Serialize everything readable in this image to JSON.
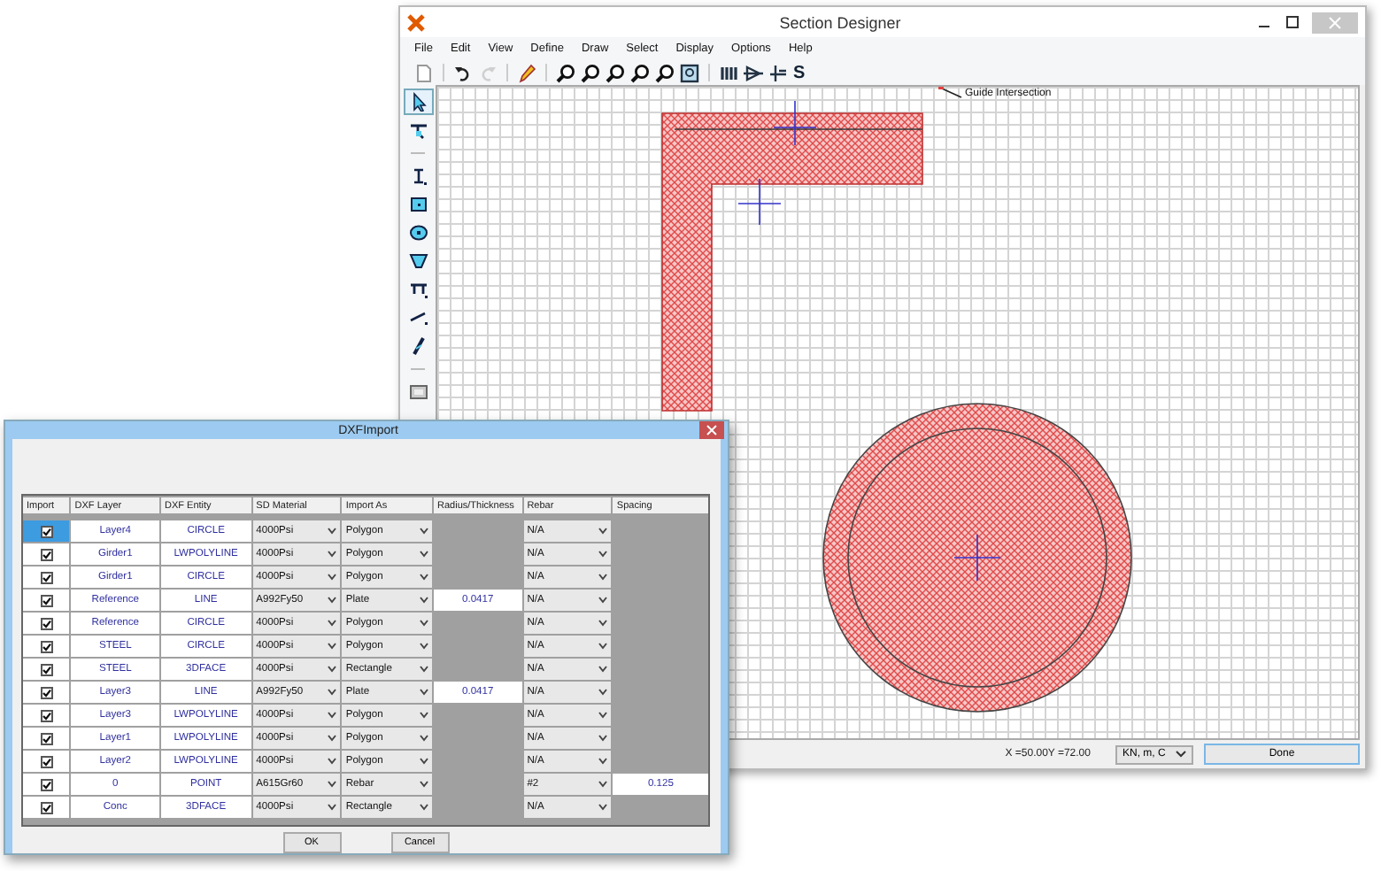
{
  "main_window": {
    "title": "Section Designer",
    "menu": [
      "File",
      "Edit",
      "View",
      "Define",
      "Draw",
      "Select",
      "Display",
      "Options",
      "Help"
    ],
    "toolbar": [
      {
        "kind": "new"
      },
      {
        "kind": "sep"
      },
      {
        "kind": "undo"
      },
      {
        "kind": "redo",
        "disabled": true
      },
      {
        "kind": "sep"
      },
      {
        "kind": "pencil"
      },
      {
        "kind": "sep"
      },
      {
        "kind": "zoom"
      },
      {
        "kind": "zoom"
      },
      {
        "kind": "zoom"
      },
      {
        "kind": "zoom"
      },
      {
        "kind": "zoom"
      },
      {
        "kind": "fit"
      },
      {
        "kind": "sep"
      },
      {
        "kind": "bars"
      },
      {
        "kind": "triangle"
      },
      {
        "kind": "axis"
      },
      {
        "kind": "text",
        "label": "S"
      }
    ],
    "side_tools": [
      {
        "kind": "pointer",
        "selected": true
      },
      {
        "kind": "reshape",
        "selected": false
      },
      {
        "kind": "sep"
      },
      {
        "kind": "ibeam",
        "selected": false
      },
      {
        "kind": "rect",
        "selected": false
      },
      {
        "kind": "circle",
        "selected": false
      },
      {
        "kind": "poly",
        "selected": false
      },
      {
        "kind": "tee",
        "selected": false
      },
      {
        "kind": "line",
        "selected": false
      },
      {
        "kind": "pen",
        "selected": false
      },
      {
        "kind": "sep"
      },
      {
        "kind": "props",
        "selected": false
      }
    ],
    "canvas": {
      "guide_label": "Guide Intersection"
    },
    "status_bar": {
      "coordinates": "X =50.00Y =72.00",
      "units": "KN, m, C",
      "done_button": "Done"
    }
  },
  "dialog": {
    "title": "DXFImport",
    "columns": [
      "Import",
      "DXF Layer",
      "DXF Entity",
      "SD Material",
      "Import As",
      "Radius/Thickness",
      "Rebar",
      "Spacing"
    ],
    "rows": [
      {
        "import": true,
        "layer": "Layer4",
        "entity": "CIRCLE",
        "material": "4000Psi",
        "import_as": "Polygon",
        "rebar": "N/A",
        "selected": true
      },
      {
        "import": true,
        "layer": "Girder1",
        "entity": "LWPOLYLINE",
        "material": "4000Psi",
        "import_as": "Polygon",
        "rebar": "N/A",
        "selected": false
      },
      {
        "import": true,
        "layer": "Girder1",
        "entity": "CIRCLE",
        "material": "4000Psi",
        "import_as": "Polygon",
        "rebar": "N/A",
        "selected": false
      },
      {
        "import": true,
        "layer": "Reference",
        "entity": "LINE",
        "material": "A992Fy50",
        "import_as": "Plate",
        "radius": "0.0417",
        "rebar": "N/A",
        "selected": false
      },
      {
        "import": true,
        "layer": "Reference",
        "entity": "CIRCLE",
        "material": "4000Psi",
        "import_as": "Polygon",
        "rebar": "N/A",
        "selected": false
      },
      {
        "import": true,
        "layer": "STEEL",
        "entity": "CIRCLE",
        "material": "4000Psi",
        "import_as": "Polygon",
        "rebar": "N/A",
        "selected": false
      },
      {
        "import": true,
        "layer": "STEEL",
        "entity": "3DFACE",
        "material": "4000Psi",
        "import_as": "Rectangle",
        "rebar": "N/A",
        "selected": false
      },
      {
        "import": true,
        "layer": "Layer3",
        "entity": "LINE",
        "material": "A992Fy50",
        "import_as": "Plate",
        "radius": "0.0417",
        "rebar": "N/A",
        "selected": false
      },
      {
        "import": true,
        "layer": "Layer3",
        "entity": "LWPOLYLINE",
        "material": "4000Psi",
        "import_as": "Polygon",
        "rebar": "N/A",
        "selected": false
      },
      {
        "import": true,
        "layer": "Layer1",
        "entity": "LWPOLYLINE",
        "material": "4000Psi",
        "import_as": "Polygon",
        "rebar": "N/A",
        "selected": false
      },
      {
        "import": true,
        "layer": "Layer2",
        "entity": "LWPOLYLINE",
        "material": "4000Psi",
        "import_as": "Polygon",
        "rebar": "N/A",
        "selected": false
      },
      {
        "import": true,
        "layer": "0",
        "entity": "POINT",
        "material": "A615Gr60",
        "import_as": "Rebar",
        "rebar": "#2",
        "spacing": "0.125",
        "selected": false
      },
      {
        "import": true,
        "layer": "Conc",
        "entity": "3DFACE",
        "material": "4000Psi",
        "import_as": "Rectangle",
        "rebar": "N/A",
        "selected": false
      }
    ],
    "buttons": [
      "OK",
      "Cancel"
    ]
  }
}
